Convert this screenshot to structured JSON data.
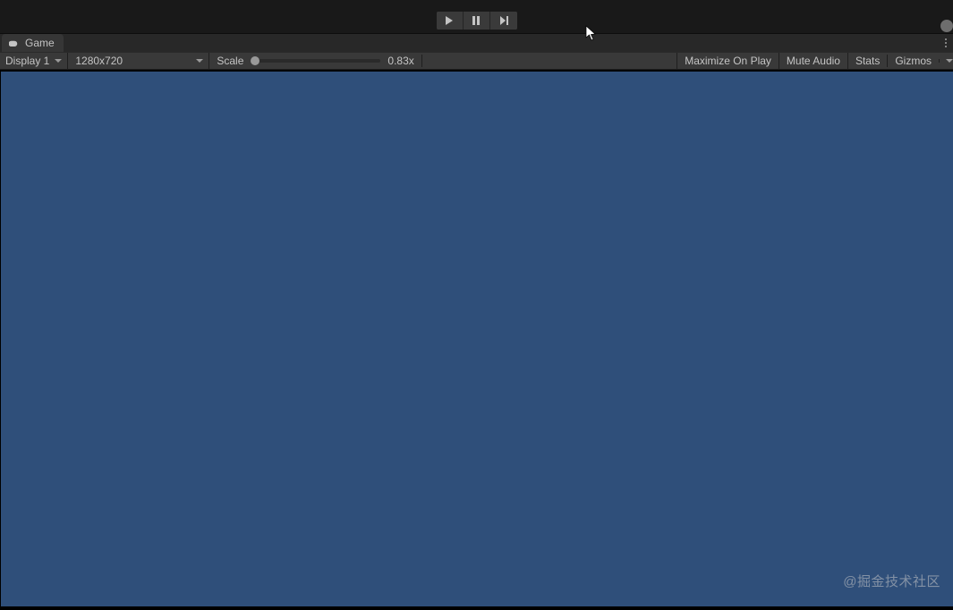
{
  "playback": {
    "play": "play",
    "pause": "pause",
    "step": "step"
  },
  "tab": {
    "label": "Game"
  },
  "controlbar": {
    "display_label": "Display 1",
    "resolution": "1280x720",
    "scale_label": "Scale",
    "scale_value": "0.83x",
    "maximize": "Maximize On Play",
    "mute": "Mute Audio",
    "stats": "Stats",
    "gizmos": "Gizmos"
  },
  "viewport": {
    "background_color": "#2f4f7a"
  },
  "watermark": "@掘金技术社区"
}
